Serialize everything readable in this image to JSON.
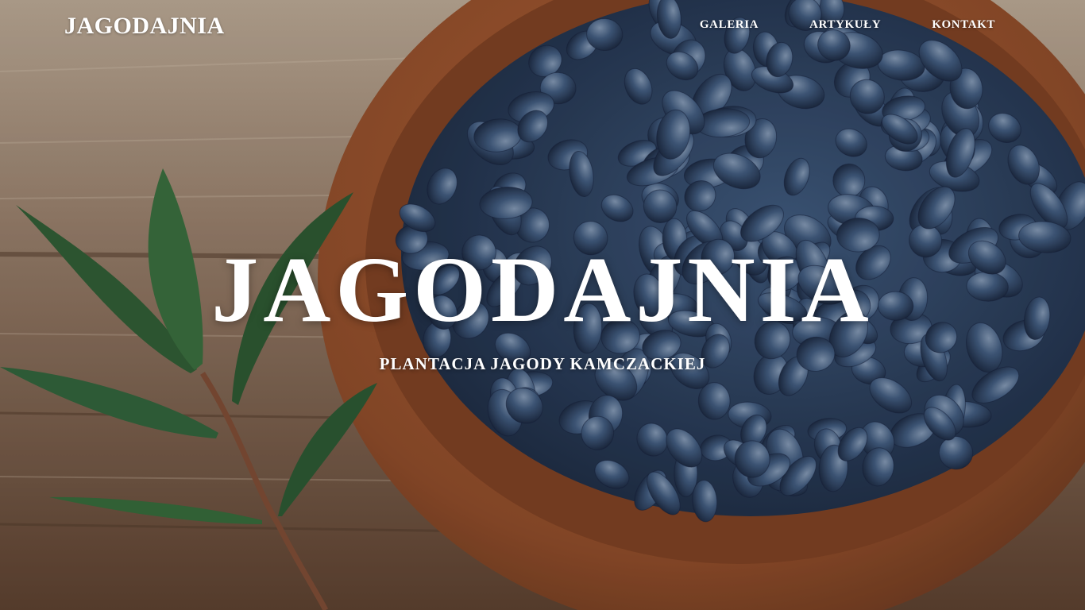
{
  "header": {
    "logo": "JAGODAJNIA",
    "nav": [
      {
        "label": "GALERIA"
      },
      {
        "label": "ARTYKUŁY"
      },
      {
        "label": "KONTAKT"
      }
    ]
  },
  "hero": {
    "title": "JAGODAJNIA",
    "subtitle": "PLANTACJA JAGODY KAMCZACKIEJ",
    "image": "wooden bowl of blue honeysuckle berries with a leafy sprig on a wooden table"
  },
  "colors": {
    "text": "#ffffff",
    "wood": "#8a6f5a",
    "bowl": "#8b4a2b",
    "berry": "#2e4566",
    "leaf": "#2f5a33"
  }
}
